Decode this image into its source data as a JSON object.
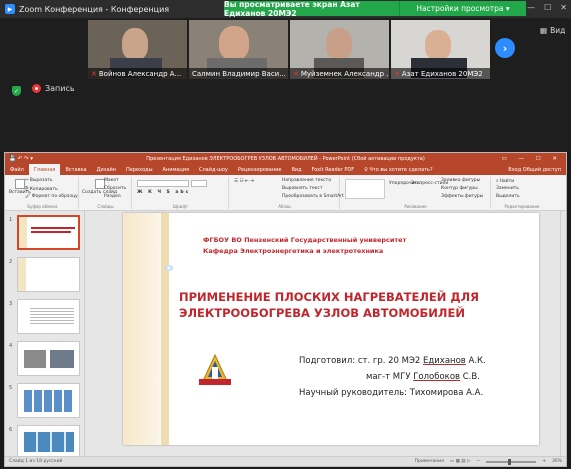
{
  "zoom": {
    "window_title": "Zoom Конференция - Конференция",
    "share_banner": "Вы просматриваете экран Азат Едиханов 20МЭ2",
    "view_options": "Настройки просмотра ▾",
    "view_label": "Вид",
    "record_label": "Запись",
    "participants": [
      {
        "name": "Войнов Александр А..."
      },
      {
        "name": "Салмин Владимир Васи..."
      },
      {
        "name": "Муйземнек Александр ..."
      },
      {
        "name": "Азат Едиханов 20МЭ2"
      }
    ]
  },
  "ppt": {
    "title": "Презентация Едиханов ЭЛЕКТРООБОГРЕВ УЗЛОВ АВТОМОБИЛЕЙ - PowerPoint (Сбой активации продукта)",
    "tabs": [
      "Файл",
      "Главная",
      "Вставка",
      "Дизайн",
      "Переходы",
      "Анимация",
      "Слайд-шоу",
      "Рецензирование",
      "Вид",
      "Foxit Reader PDF",
      "♀ Что вы хотите сделать?"
    ],
    "tab_right": "Вход  Общий доступ",
    "ribbon": {
      "paste": "Вставить",
      "cut": "Вырезать",
      "copy": "Копировать",
      "format": "Формат по образцу",
      "clipboard": "Буфер обмена",
      "new_slide": "Создать слайд",
      "layout": "Макет",
      "reset": "Сбросить",
      "section": "Раздел",
      "slides": "Слайды",
      "font": "Шрифт",
      "text_dir": "Направление текста",
      "align_text": "Выровнять текст",
      "smartart": "Преобразовать в SmartArt",
      "paragraph": "Абзац",
      "arrange": "Упорядочить",
      "quick_styles": "Экспресс-стили",
      "fill": "Заливка фигуры",
      "outline": "Контур фигуры",
      "effects": "Эффекты фигуры",
      "drawing": "Рисование",
      "find": "Найти",
      "replace": "Заменить",
      "select": "Выделить",
      "editing": "Редактирование"
    },
    "slide": {
      "university": "ФГБОУ ВО Пензенский Государственный университет",
      "department": "Кафедра Электроэнергетика и электротехника",
      "title_line1": "ПРИМЕНЕНИЕ ПЛОСКИХ НАГРЕВАТЕЛЕЙ ДЛЯ",
      "title_line2": "ЭЛЕКТРООБОГРЕВА УЗЛОВ  АВТОМОБИЛЕЙ",
      "prepared_label": "Подготовил:  ст. гр. 20 МЭ2 ",
      "author1": "Едиханов",
      "author1_suffix": " А.К.",
      "mag_prefix": "маг-т МГУ ",
      "author2": "Голобоков",
      "author2_suffix": " С.В.",
      "supervisor": "Научный руководитель: Тихомирова А.А."
    },
    "slide_numbers": [
      "1",
      "2",
      "3",
      "4",
      "5",
      "6"
    ],
    "status_left": "Слайд 1 из 18    русский",
    "status_notes": "Примечания",
    "status_zoom": "36%"
  }
}
